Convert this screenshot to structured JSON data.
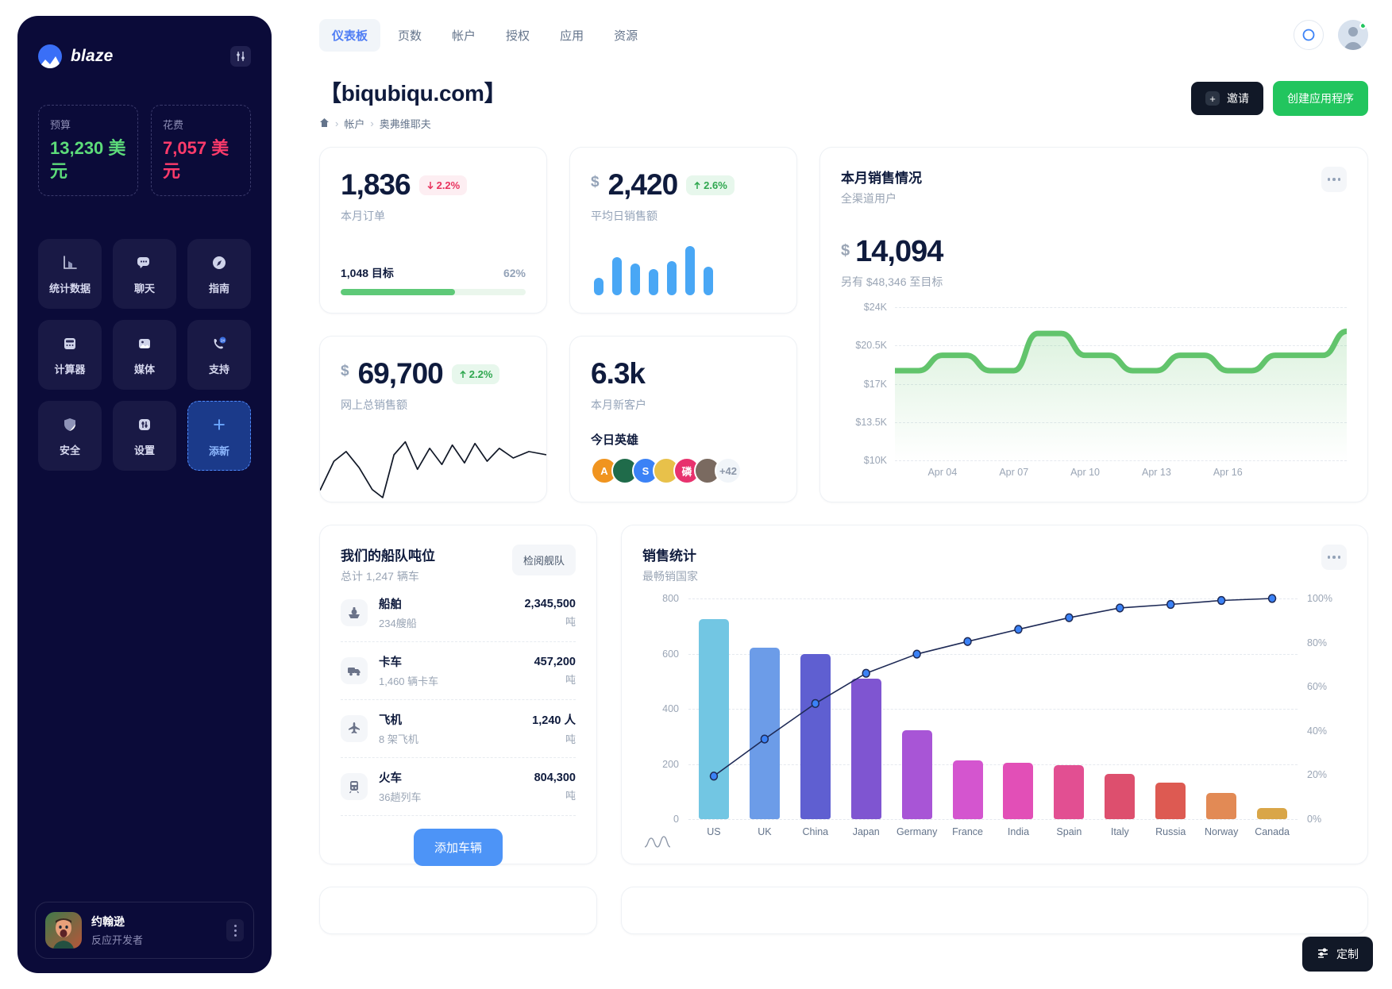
{
  "sidebar": {
    "brand": "blaze",
    "brand_logo_icon": "blaze-logo-icon",
    "toggle_icon": "sliders-icon",
    "budget": {
      "label": "预算",
      "value": "13,230 美元",
      "color": "#5ddc7a"
    },
    "spend": {
      "label": "花费",
      "value": "7,057 美元",
      "color": "#ff3b6b"
    },
    "tiles": [
      {
        "label": "统计数据",
        "icon": "bar-chart-icon"
      },
      {
        "label": "聊天",
        "icon": "chat-bubble-icon"
      },
      {
        "label": "指南",
        "icon": "compass-icon"
      },
      {
        "label": "计算器",
        "icon": "calculator-icon"
      },
      {
        "label": "媒体",
        "icon": "image-icon"
      },
      {
        "label": "支持",
        "icon": "phone-24-icon"
      },
      {
        "label": "安全",
        "icon": "shield-icon"
      },
      {
        "label": "设置",
        "icon": "sliders-icon"
      },
      {
        "label": "添新",
        "icon": "plus-icon"
      }
    ],
    "profile": {
      "name": "约翰逊",
      "role": "反应开发者",
      "menu_icon": "kebab-menu-icon"
    }
  },
  "topbar": {
    "tabs": [
      {
        "label": "仪表板",
        "active": true
      },
      {
        "label": "页数",
        "active": false
      },
      {
        "label": "帐户",
        "active": false
      },
      {
        "label": "授权",
        "active": false
      },
      {
        "label": "应用",
        "active": false
      },
      {
        "label": "资源",
        "active": false
      }
    ],
    "search_icon": "circle-search-icon",
    "account_icon": "user-avatar-icon"
  },
  "header": {
    "title": "【biqubiqu.com】",
    "breadcrumb": {
      "home_icon": "home-icon",
      "items": [
        "帐户",
        "奥弗维耶夫"
      ],
      "separator": "›"
    },
    "invite_button": {
      "label": "邀请",
      "icon": "plus-icon"
    },
    "create_button": {
      "label": "创建应用程序"
    }
  },
  "kpi_orders": {
    "value": "1,836",
    "delta": "2.2%",
    "delta_dir": "down",
    "delta_icon": "arrow-down-icon",
    "subtitle": "本月订单",
    "goal_label": "1,048 目标",
    "goal_pct": "62%",
    "goal_fill": 62
  },
  "kpi_avg_sales": {
    "currency": "$",
    "value": "2,420",
    "delta": "2.6%",
    "delta_dir": "up",
    "delta_icon": "arrow-up-icon",
    "subtitle": "平均日销售额",
    "bars": [
      22,
      48,
      40,
      33,
      43,
      62,
      36
    ]
  },
  "kpi_total_online": {
    "currency": "$",
    "value": "69,700",
    "delta": "2.2%",
    "delta_dir": "up",
    "delta_icon": "arrow-up-icon",
    "subtitle": "网上总销售额"
  },
  "kpi_new_customers": {
    "value": "6.3k",
    "subtitle": "本月新客户",
    "heroes_title": "今日英雄",
    "heroes": [
      {
        "initial": "A",
        "color": "#f0941f"
      },
      {
        "initial": "",
        "color": "#1f6b4a"
      },
      {
        "initial": "S",
        "color": "#3b82f6"
      },
      {
        "initial": "",
        "color": "#e8c14a"
      },
      {
        "initial": "磷",
        "color": "#e8326e"
      },
      {
        "initial": "",
        "color": "#7a6a60"
      }
    ],
    "more": "+42"
  },
  "sales_card": {
    "title": "本月销售情况",
    "subtitle": "全渠道用户",
    "currency": "$",
    "value": "14,094",
    "note": "另有 $48,346 至目标",
    "menu_icon": "kebab-menu-icon"
  },
  "fleet": {
    "title": "我们的船队吨位",
    "subtitle": "总计 1,247 辆车",
    "review_button": "检阅舰队",
    "rows": [
      {
        "name": "船舶",
        "count": "234艘船",
        "value": "2,345,500",
        "unit": "吨",
        "icon": "ship-icon"
      },
      {
        "name": "卡车",
        "count": "1,460 辆卡车",
        "value": "457,200",
        "unit": "吨",
        "icon": "truck-icon"
      },
      {
        "name": "飞机",
        "count": "8 架飞机",
        "value": "1,240 人",
        "unit": "吨",
        "icon": "plane-icon"
      },
      {
        "name": "火车",
        "count": "36趟列车",
        "value": "804,300",
        "unit": "吨",
        "icon": "train-icon"
      }
    ],
    "add_button": "添加车辆"
  },
  "stats_card": {
    "title": "销售统计",
    "subtitle": "最畅销国家",
    "menu_icon": "kebab-menu-icon",
    "footer_icon": "wave-chart-icon"
  },
  "customize": {
    "label": "定制",
    "icon": "tune-icon"
  },
  "chart_data": [
    {
      "type": "area",
      "name": "monthly-sales-line",
      "title": "本月销售情况",
      "subtitle": "全渠道用户",
      "xlabel": "",
      "ylabel": "",
      "ytick_labels": [
        "$24K",
        "$20.5K",
        "$17K",
        "$13.5K",
        "$10K"
      ],
      "ylim": [
        10000,
        24000
      ],
      "xtick_labels": [
        "Apr 04",
        "Apr 07",
        "Apr 10",
        "Apr 13",
        "Apr 16"
      ],
      "grid": true,
      "legend": "none",
      "line_color": "#62c46c",
      "x": [
        1,
        2,
        3,
        4,
        5,
        6,
        7,
        8,
        9,
        10,
        11,
        12,
        13,
        14,
        15,
        16,
        17,
        18,
        19,
        20
      ],
      "values": [
        18200,
        18200,
        19600,
        19600,
        18200,
        18200,
        21600,
        21600,
        19600,
        19600,
        18200,
        18200,
        19600,
        19600,
        18200,
        18200,
        19600,
        19600,
        19600,
        21800
      ]
    },
    {
      "type": "bar",
      "name": "sales-statistics-pareto",
      "title": "销售统计",
      "subtitle": "最畅销国家",
      "categories": [
        "US",
        "UK",
        "China",
        "Japan",
        "Germany",
        "France",
        "India",
        "Spain",
        "Italy",
        "Russia",
        "Norway",
        "Canada"
      ],
      "values": [
        725,
        623,
        600,
        508,
        322,
        213,
        204,
        197,
        165,
        133,
        95,
        40
      ],
      "bar_colors": [
        "#72c6e3",
        "#6c9ce8",
        "#5f5fd1",
        "#7f55d1",
        "#a855d6",
        "#d455cf",
        "#e24fb7",
        "#e24f92",
        "#dd4f6e",
        "#dd5a52",
        "#e28a55",
        "#d9a648"
      ],
      "ylabel": "",
      "ylim": [
        0,
        800
      ],
      "ytick_labels": [
        "0",
        "200",
        "400",
        "600",
        "800"
      ],
      "secondary_axis": {
        "name": "cumulative-percent",
        "ytick_labels": [
          "0%",
          "20%",
          "40%",
          "60%",
          "80%",
          "100%"
        ],
        "ylim": [
          0,
          100
        ],
        "values": [
          19.5,
          36.3,
          52.4,
          66.1,
          74.8,
          80.5,
          86.0,
          91.3,
          95.7,
          97.3,
          99.1,
          100.0
        ],
        "line_color": "#1e2a56",
        "marker_color": "#3b82f6"
      },
      "grid": true,
      "legend": "none"
    },
    {
      "type": "bar",
      "name": "avg-daily-sales-mini-bars",
      "categories": [
        "1",
        "2",
        "3",
        "4",
        "5",
        "6",
        "7"
      ],
      "values": [
        22,
        48,
        40,
        33,
        43,
        62,
        36
      ],
      "ylim": [
        0,
        62
      ],
      "bar_color": "#49a7f5",
      "grid": false,
      "legend": "none"
    },
    {
      "type": "line",
      "name": "total-online-sales-sparkline",
      "x": [
        0,
        1,
        2,
        3,
        4,
        5,
        6,
        7,
        8,
        9,
        10,
        11,
        12,
        13,
        14,
        15,
        16
      ],
      "values": [
        52,
        56,
        44,
        30,
        8,
        48,
        62,
        40,
        56,
        42,
        58,
        44,
        60,
        46,
        56,
        50,
        54
      ],
      "line_color": "#111827",
      "grid": false,
      "legend": "none"
    }
  ]
}
